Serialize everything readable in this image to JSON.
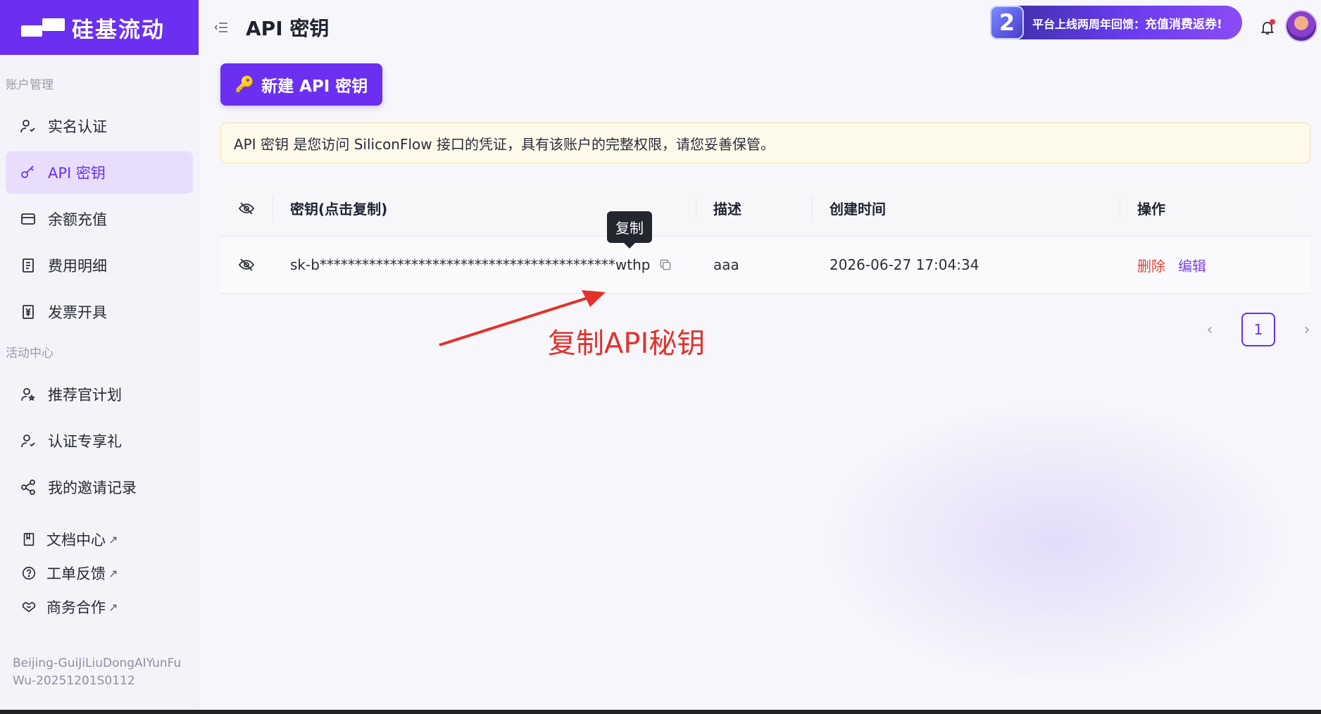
{
  "brand": {
    "name": "硅基流动"
  },
  "header": {
    "title": "API 密钥",
    "promo_badge": "2",
    "promo_text": "平台上线两周年回馈：",
    "promo_highlight": "充值消费返券!"
  },
  "sidebar": {
    "section_account": "账户管理",
    "account_items": [
      {
        "label": "实名认证",
        "icon": "user-check-icon"
      },
      {
        "label": "API 密钥",
        "icon": "key-icon",
        "active": true
      },
      {
        "label": "余额充值",
        "icon": "credit-card-icon"
      },
      {
        "label": "费用明细",
        "icon": "receipt-icon"
      },
      {
        "label": "发票开具",
        "icon": "invoice-icon"
      }
    ],
    "section_activity": "活动中心",
    "activity_items": [
      {
        "label": "推荐官计划",
        "icon": "user-star-icon"
      },
      {
        "label": "认证专享礼",
        "icon": "user-gift-icon"
      },
      {
        "label": "我的邀请记录",
        "icon": "share-icon"
      }
    ],
    "links": [
      {
        "label": "文档中心",
        "icon": "book-icon"
      },
      {
        "label": "工单反馈",
        "icon": "help-circle-icon"
      },
      {
        "label": "商务合作",
        "icon": "handshake-icon"
      }
    ],
    "external_mark": "↗",
    "org_id": "Beijing-GuiJiLiuDongAIYunFuWu-20251201S0112"
  },
  "main": {
    "new_key_button": "新建 API 密钥",
    "notice": "API 密钥 是您访问 SiliconFlow 接口的凭证，具有该账户的完整权限，请您妥善保管。",
    "table": {
      "columns": [
        "密钥(点击复制)",
        "描述",
        "创建时间",
        "操作"
      ],
      "rows": [
        {
          "key": "sk-b******************************************wthp",
          "description": "aaa",
          "created": "2026-06-27 17:04:34",
          "delete": "删除",
          "edit": "编辑"
        }
      ]
    },
    "tooltip": "复制",
    "pagination": {
      "current": "1",
      "prev": "‹",
      "next": "›"
    }
  },
  "annotation": {
    "text": "复制API秘钥",
    "color": "#e2322c"
  },
  "colors": {
    "accent": "#6a2ff0",
    "danger": "#e0443a",
    "notice_bg": "#fefaea"
  }
}
